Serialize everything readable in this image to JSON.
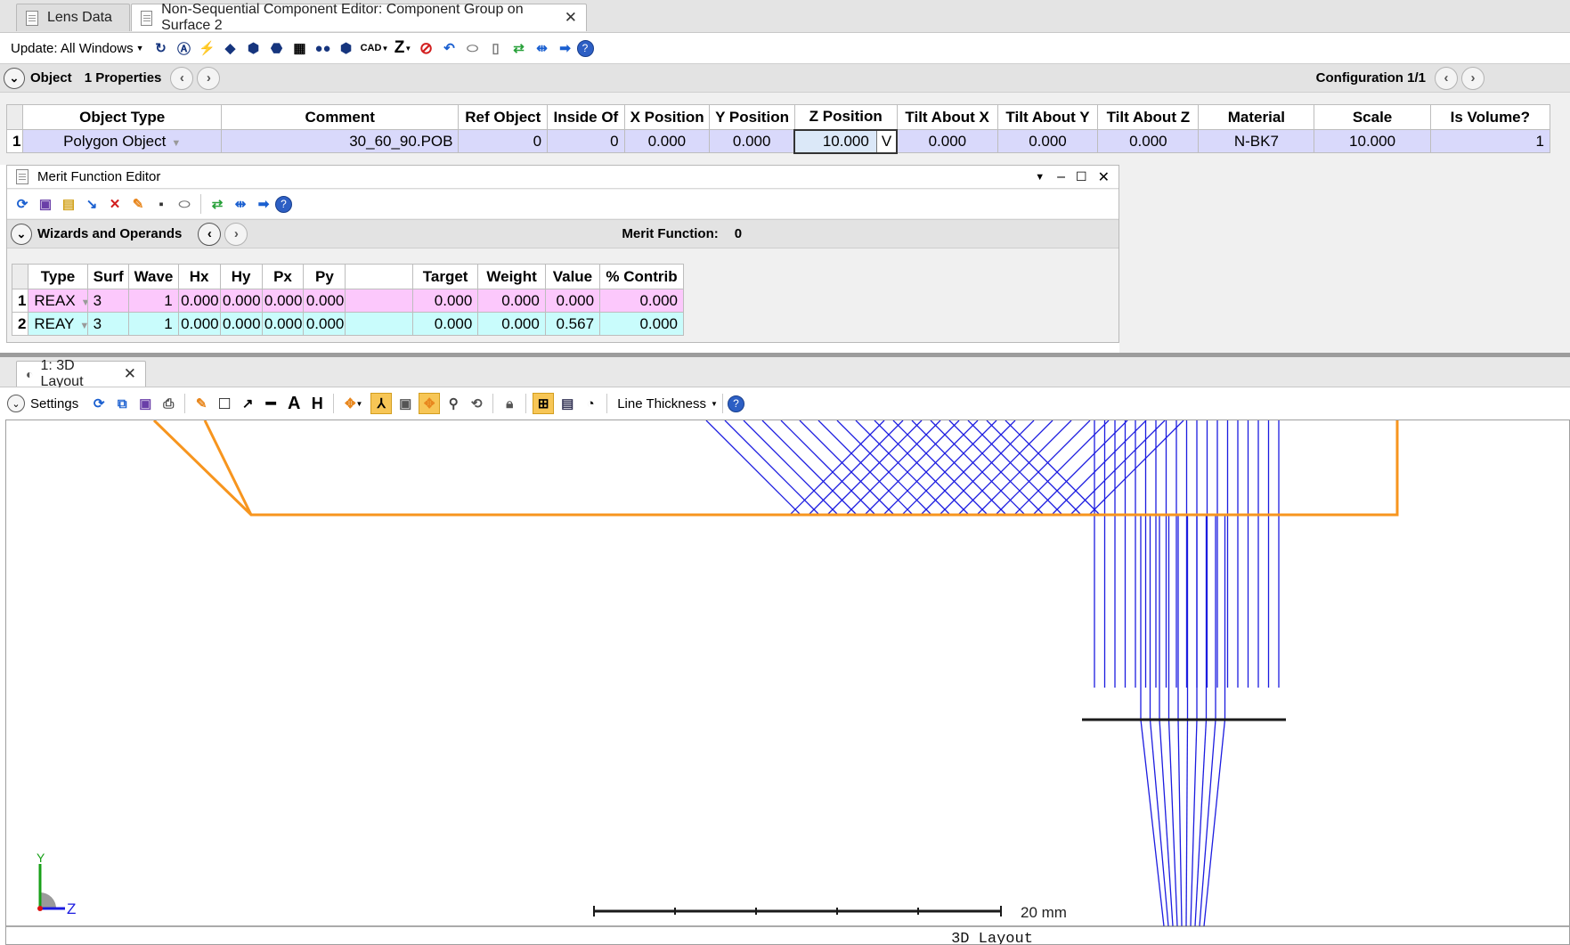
{
  "tabs": [
    {
      "label": "Lens Data",
      "active": false
    },
    {
      "label": "Non-Sequential Component Editor: Component Group on Surface 2",
      "active": true
    }
  ],
  "main_toolbar": {
    "update_label": "Update: All Windows",
    "cad_label": "CAD",
    "z_label": "Z",
    "icons": [
      "refresh-all-icon",
      "convert-icon",
      "ray-trace-icon",
      "layout-icon",
      "solid-model-icon",
      "shaded-model-icon",
      "grid-icon",
      "dots-icon",
      "object-icon",
      "cad-icon",
      "zemax-icon",
      "stop-icon",
      "undo-icon",
      "toggle-icon",
      "page-icon",
      "swap-icon",
      "left-right-icon",
      "right-arrow-icon",
      "help-icon"
    ]
  },
  "object_bar": {
    "title": "Object",
    "properties": "1 Properties",
    "configuration": "Configuration 1/1"
  },
  "nsce_table": {
    "columns": [
      "Object Type",
      "Comment",
      "Ref Object",
      "Inside Of",
      "X Position",
      "Y Position",
      "Z Position",
      "Tilt About X",
      "Tilt About Y",
      "Tilt About Z",
      "Material",
      "Scale",
      "Is Volume?"
    ],
    "rows": [
      {
        "num": "1",
        "object_type": "Polygon Object",
        "comment": "30_60_90.POB",
        "ref_object": "0",
        "inside_of": "0",
        "x_position": "0.000",
        "y_position": "0.000",
        "z_position": "10.000",
        "z_solve": "V",
        "tilt_x": "0.000",
        "tilt_y": "0.000",
        "tilt_z": "0.000",
        "material": "N-BK7",
        "scale": "10.000",
        "is_volume": "1"
      }
    ],
    "row_color": "#d9d9fb"
  },
  "mfe": {
    "title": "Merit Function Editor",
    "section": "Wizards and Operands",
    "merit_label": "Merit Function:",
    "merit_value": "0",
    "columns": [
      "Type",
      "Surf",
      "Wave",
      "Hx",
      "Hy",
      "Px",
      "Py",
      "",
      "Target",
      "Weight",
      "Value",
      "% Contrib"
    ],
    "rows": [
      {
        "num": "1",
        "type": "REAX",
        "surf": "3",
        "wave": "1",
        "hx": "0.000",
        "hy": "0.000",
        "px": "0.000",
        "py": "0.000",
        "target": "0.000",
        "weight": "0.000",
        "value": "0.000",
        "contrib": "0.000",
        "color": "#fcc8fc"
      },
      {
        "num": "2",
        "type": "REAY",
        "surf": "3",
        "wave": "1",
        "hx": "0.000",
        "hy": "0.000",
        "px": "0.000",
        "py": "0.000",
        "target": "0.000",
        "weight": "0.000",
        "value": "0.567",
        "contrib": "0.000",
        "color": "#c9fcfc"
      }
    ]
  },
  "layout_window": {
    "tab_label": "1: 3D Layout",
    "settings_label": "Settings",
    "line_thickness_label": "Line Thickness",
    "scale_bar_label": "20 mm",
    "plot_title": "3D Layout",
    "axis_labels": {
      "y": "Y",
      "z": "Z"
    },
    "colors": {
      "prism": "#f7951e",
      "rays": "#1c1ce0",
      "detector": "#1a1a1a",
      "axis_y": "#18a018",
      "axis_z": "#1919e0"
    }
  }
}
